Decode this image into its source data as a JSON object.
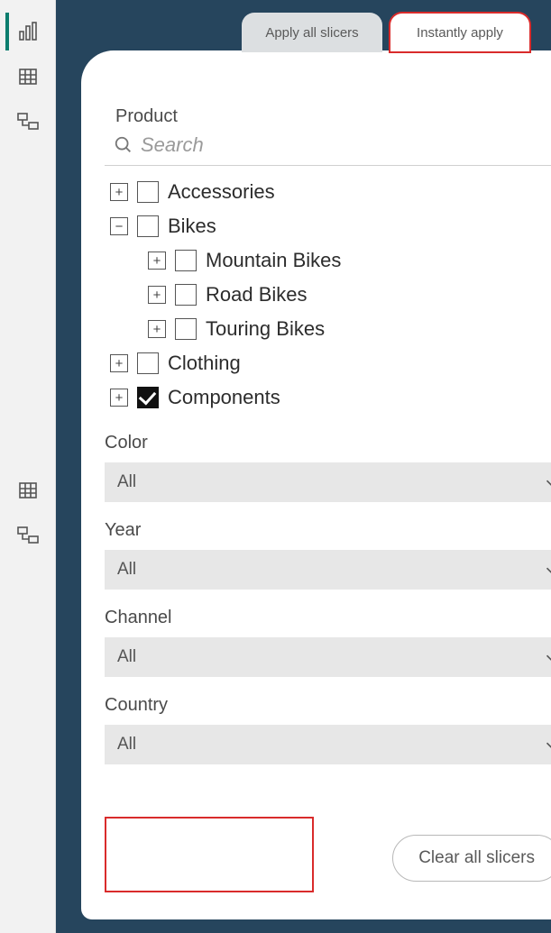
{
  "tabs": {
    "apply_all": "Apply all slicers",
    "instantly": "Instantly apply"
  },
  "product": {
    "title": "Product",
    "search_placeholder": "Search",
    "tree": {
      "accessories": {
        "label": "Accessories",
        "expand": "+"
      },
      "bikes": {
        "label": "Bikes",
        "expand": "−",
        "children": {
          "mountain": {
            "label": "Mountain Bikes",
            "expand": "+"
          },
          "road": {
            "label": "Road Bikes",
            "expand": "+"
          },
          "touring": {
            "label": "Touring Bikes",
            "expand": "+"
          }
        }
      },
      "clothing": {
        "label": "Clothing",
        "expand": "+"
      },
      "components": {
        "label": "Components",
        "expand": "+",
        "checked": true
      }
    }
  },
  "slicers": {
    "color": {
      "title": "Color",
      "value": "All"
    },
    "year": {
      "title": "Year",
      "value": "All"
    },
    "channel": {
      "title": "Channel",
      "value": "All"
    },
    "country": {
      "title": "Country",
      "value": "All"
    }
  },
  "buttons": {
    "clear_all": "Clear all slicers"
  },
  "colors": {
    "highlight": "#d92b2b",
    "canvas_bg": "#26455d"
  }
}
